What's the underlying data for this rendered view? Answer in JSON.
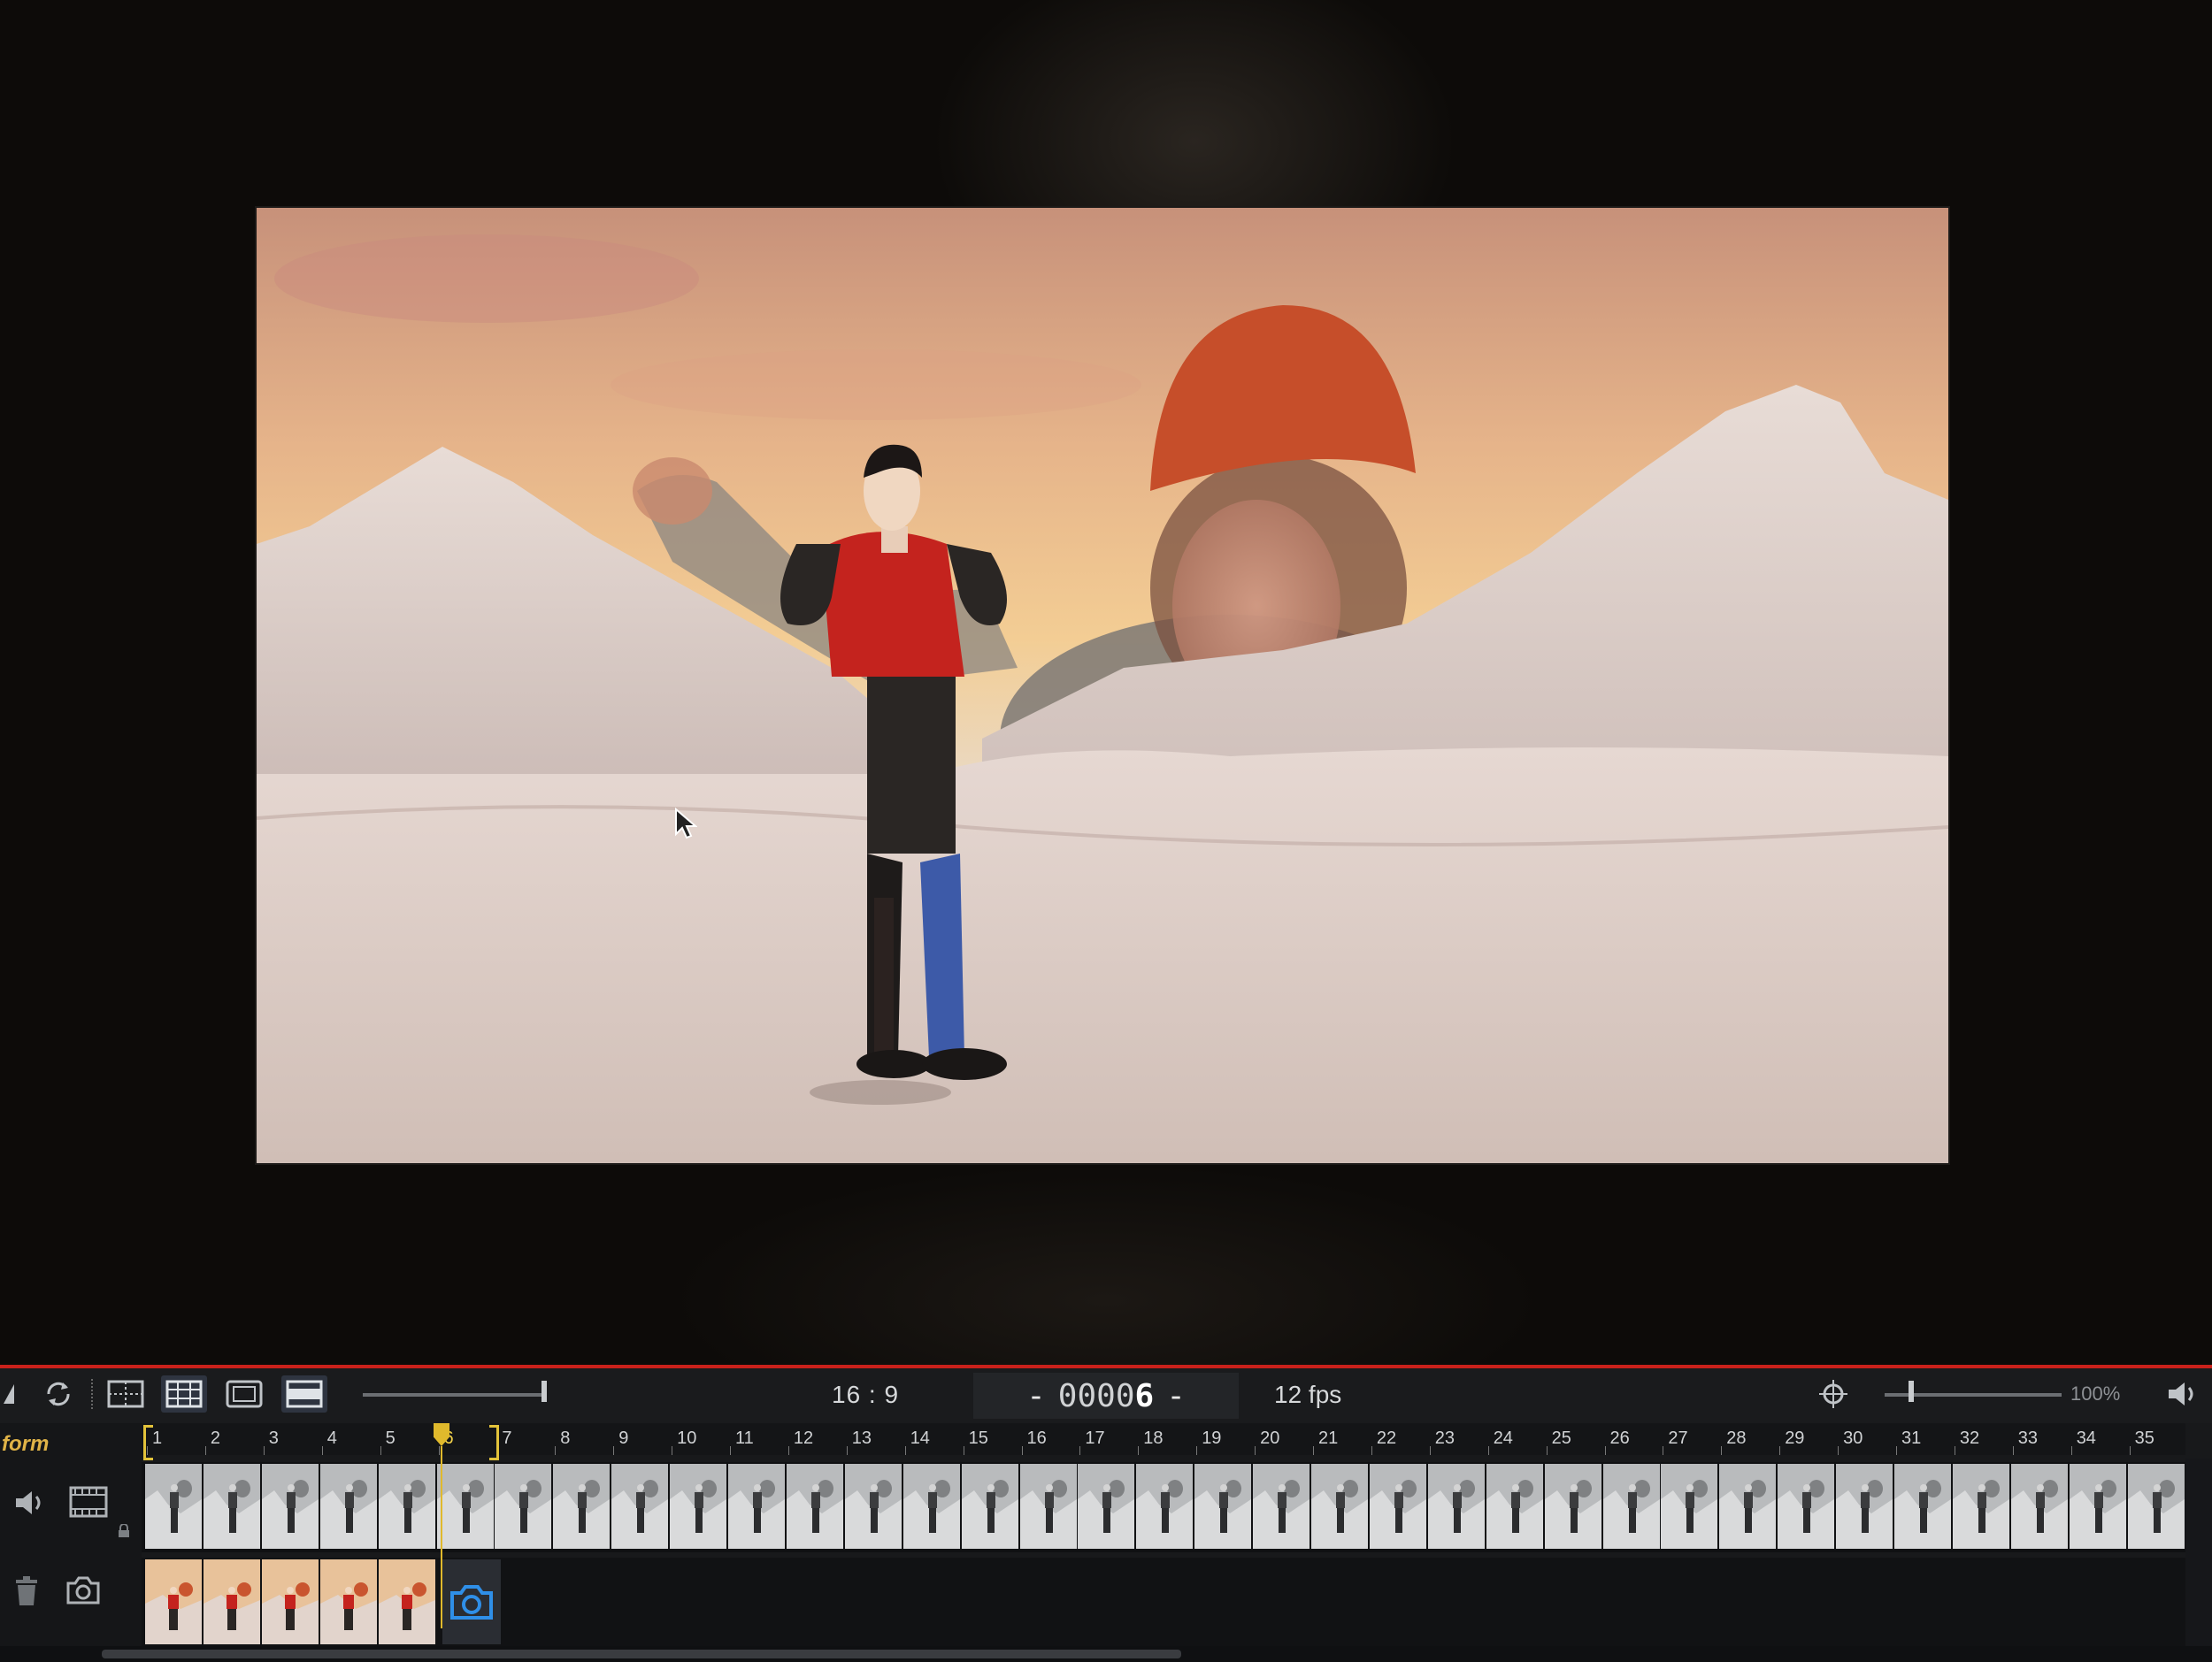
{
  "toolbar": {
    "aspect_ratio": "16 : 9",
    "frame_prefix": "-",
    "frame_number_dim": "0000",
    "frame_number_current": "6",
    "frame_suffix": "-",
    "fps": "12 fps",
    "zoom": "100%",
    "time_slider_value": 1.0,
    "zoom_slider_value": 0.13
  },
  "timeline": {
    "layer_name": "form",
    "frame_labels": [
      "1",
      "2",
      "3",
      "4",
      "5",
      "6",
      "7",
      "8",
      "9",
      "10",
      "11",
      "12",
      "13",
      "14",
      "15",
      "16",
      "17",
      "18",
      "19",
      "20",
      "21",
      "22",
      "23",
      "24",
      "25",
      "26",
      "27",
      "28",
      "29",
      "30",
      "31",
      "32",
      "33",
      "34",
      "35"
    ],
    "current_frame": 6,
    "selection_start": 1,
    "selection_end": 6,
    "captured_frames": 5
  },
  "colors": {
    "accent_red": "#c9211b",
    "playhead_yellow": "#e0b92c",
    "capture_blue": "#2f8fe8"
  },
  "icons": {
    "cursor": "arrow-cursor-icon",
    "loop": "loop-icon",
    "onion": "onion-skin-icon",
    "grid": "grid-icon",
    "frame": "frame-guide-icon",
    "letterbox": "letterbox-icon",
    "target": "crosshair-icon",
    "volume": "volume-icon",
    "filmstrip": "filmstrip-icon",
    "trash": "trash-icon",
    "camera": "camera-icon"
  }
}
